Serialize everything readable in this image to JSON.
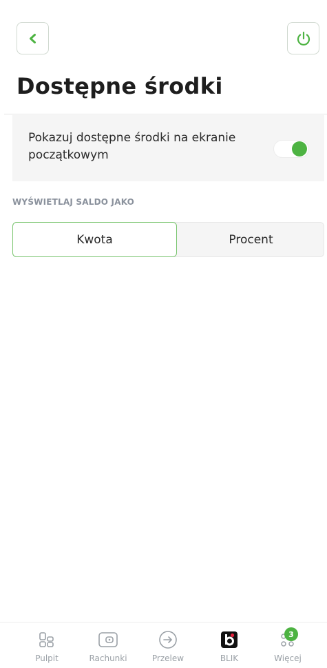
{
  "header": {
    "back_icon": "chevron-left-icon",
    "power_icon": "power-icon",
    "title": "Dostępne środki"
  },
  "setting": {
    "label": "Pokazuj dostępne środki na ekranie początkowym",
    "toggle_on": true
  },
  "balance_display": {
    "section_label": "WYŚWIETLAJ SALDO JAKO",
    "options": [
      "Kwota",
      "Procent"
    ],
    "selected": "Kwota"
  },
  "bottom_nav": {
    "items": [
      {
        "label": "Pulpit",
        "icon": "dashboard-icon"
      },
      {
        "label": "Rachunki",
        "icon": "wallet-icon"
      },
      {
        "label": "Przelew",
        "icon": "transfer-icon"
      },
      {
        "label": "BLIK",
        "icon": "blik-icon"
      },
      {
        "label": "Więcej",
        "icon": "more-icon",
        "badge": "3"
      }
    ]
  },
  "colors": {
    "accent": "#4db342",
    "icon_gray": "#9aa0a6",
    "card_bg": "#f5f5f5"
  }
}
